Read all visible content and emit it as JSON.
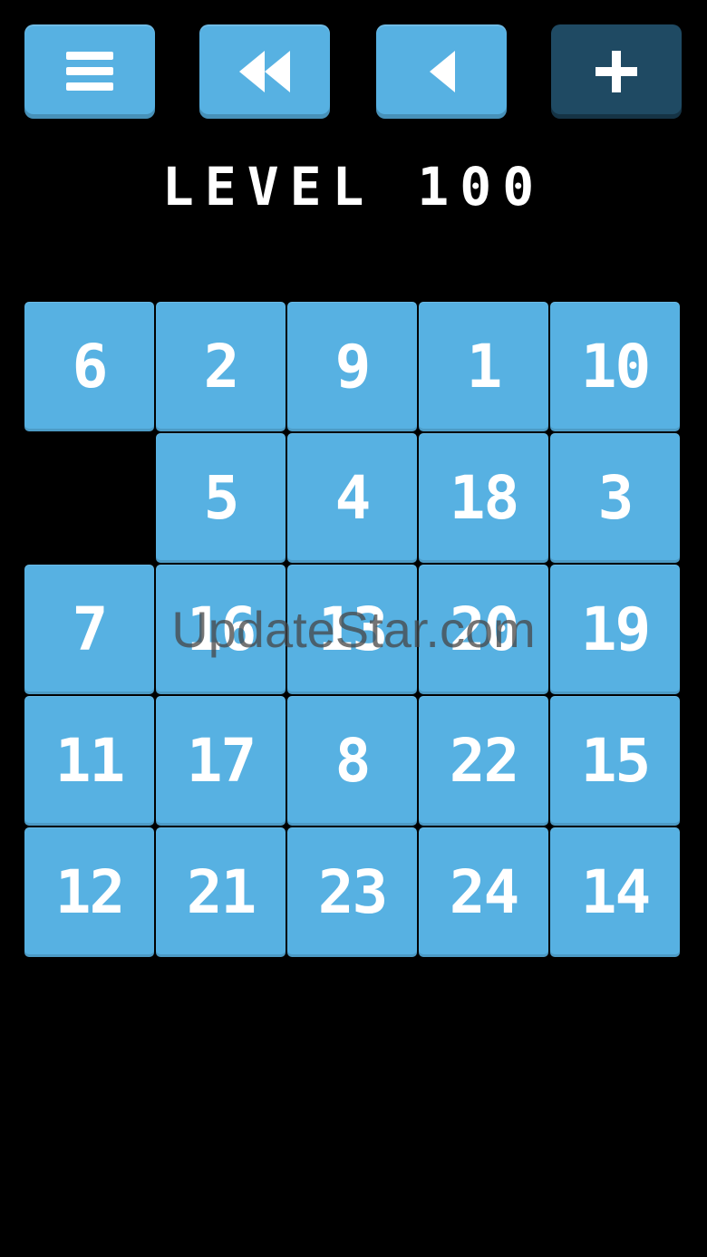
{
  "toolbar": {
    "menu_icon": "menu-icon",
    "rewind_icon": "rewind-icon",
    "back_icon": "back-icon",
    "plus_icon": "plus-icon",
    "button_color": "#57b1e2",
    "disabled_button_color": "#1f4a63"
  },
  "level": {
    "title": "LEVEL 100"
  },
  "board": {
    "tile_color": "#57b1e2",
    "rows": [
      [
        "6",
        "2",
        "9",
        "1",
        "10"
      ],
      [
        "",
        "5",
        "4",
        "18",
        "3"
      ],
      [
        "7",
        "16",
        "13",
        "20",
        "19"
      ],
      [
        "11",
        "17",
        "8",
        "22",
        "15"
      ],
      [
        "12",
        "21",
        "23",
        "24",
        "14"
      ]
    ]
  },
  "watermark": {
    "text": "UpdateStar.com"
  }
}
